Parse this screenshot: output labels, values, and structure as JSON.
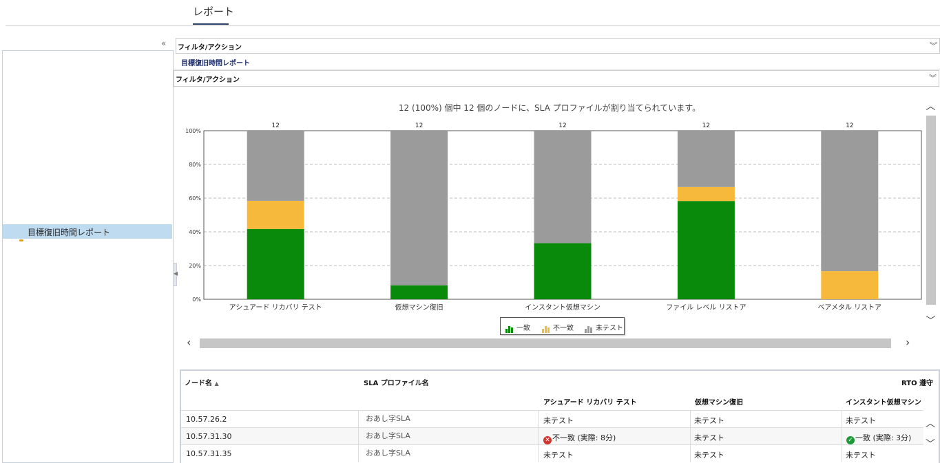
{
  "header": {
    "tab_label": "レポート"
  },
  "filter_outer_label": "フィルタ/アクション",
  "report_title": "目標復旧時間レポート",
  "filter_inner_label": "フィルタ/アクション",
  "tree": {
    "selected_item": "目標復旧時間レポート"
  },
  "icons": {
    "collapse": "double-chevron-left-icon",
    "expand": "double-chevron-down-icon"
  },
  "chart_data": {
    "type": "bar",
    "stacked": true,
    "title": "12 (100%) 個中 12 個のノードに、SLA プロファイルが割り当てられています。",
    "categories": [
      "アシュアード リカバリ テスト",
      "仮想マシン復旧",
      "インスタント仮想マシン",
      "ファイル レベル リストア",
      "ベアメタル リストア"
    ],
    "totals": [
      "12",
      "12",
      "12",
      "12",
      "12"
    ],
    "yticks": [
      "0%",
      "20%",
      "40%",
      "60%",
      "80%",
      "100%"
    ],
    "ylim": [
      0,
      100
    ],
    "grid": true,
    "legend_position": "bottom-center",
    "series": [
      {
        "name": "一致",
        "color": "#0a8a0a",
        "values": [
          41.7,
          8.3,
          33.3,
          58.3,
          0
        ]
      },
      {
        "name": "不一致",
        "color": "#f6b93b",
        "values": [
          16.7,
          0,
          0,
          8.3,
          16.7
        ]
      },
      {
        "name": "未テスト",
        "color": "#9b9b9b",
        "values": [
          41.6,
          91.7,
          66.7,
          33.4,
          83.3
        ]
      }
    ]
  },
  "table": {
    "headers": {
      "node": "ノード名",
      "sla": "SLA プロファイル名",
      "rto": "RTO 遵守",
      "assured": "アシュアード リカバリ テスト",
      "vm": "仮想マシン復旧",
      "ivm": "インスタント仮想マシン"
    },
    "rows": [
      {
        "node": "10.57.26.2",
        "sla": "おあし字SLA",
        "assured": "未テスト",
        "assured_status": "",
        "vm": "未テスト",
        "ivm": "未テスト",
        "ivm_status": ""
      },
      {
        "node": "10.57.31.30",
        "sla": "おあし字SLA",
        "assured": "不一致 (実際: 8分)",
        "assured_status": "error",
        "vm": "未テスト",
        "ivm": "一致 (実際: 3分)",
        "ivm_status": "ok"
      },
      {
        "node": "10.57.31.35",
        "sla": "おあし字SLA",
        "assured": "未テスト",
        "assured_status": "",
        "vm": "未テスト",
        "ivm": "未テスト",
        "ivm_status": ""
      }
    ]
  }
}
